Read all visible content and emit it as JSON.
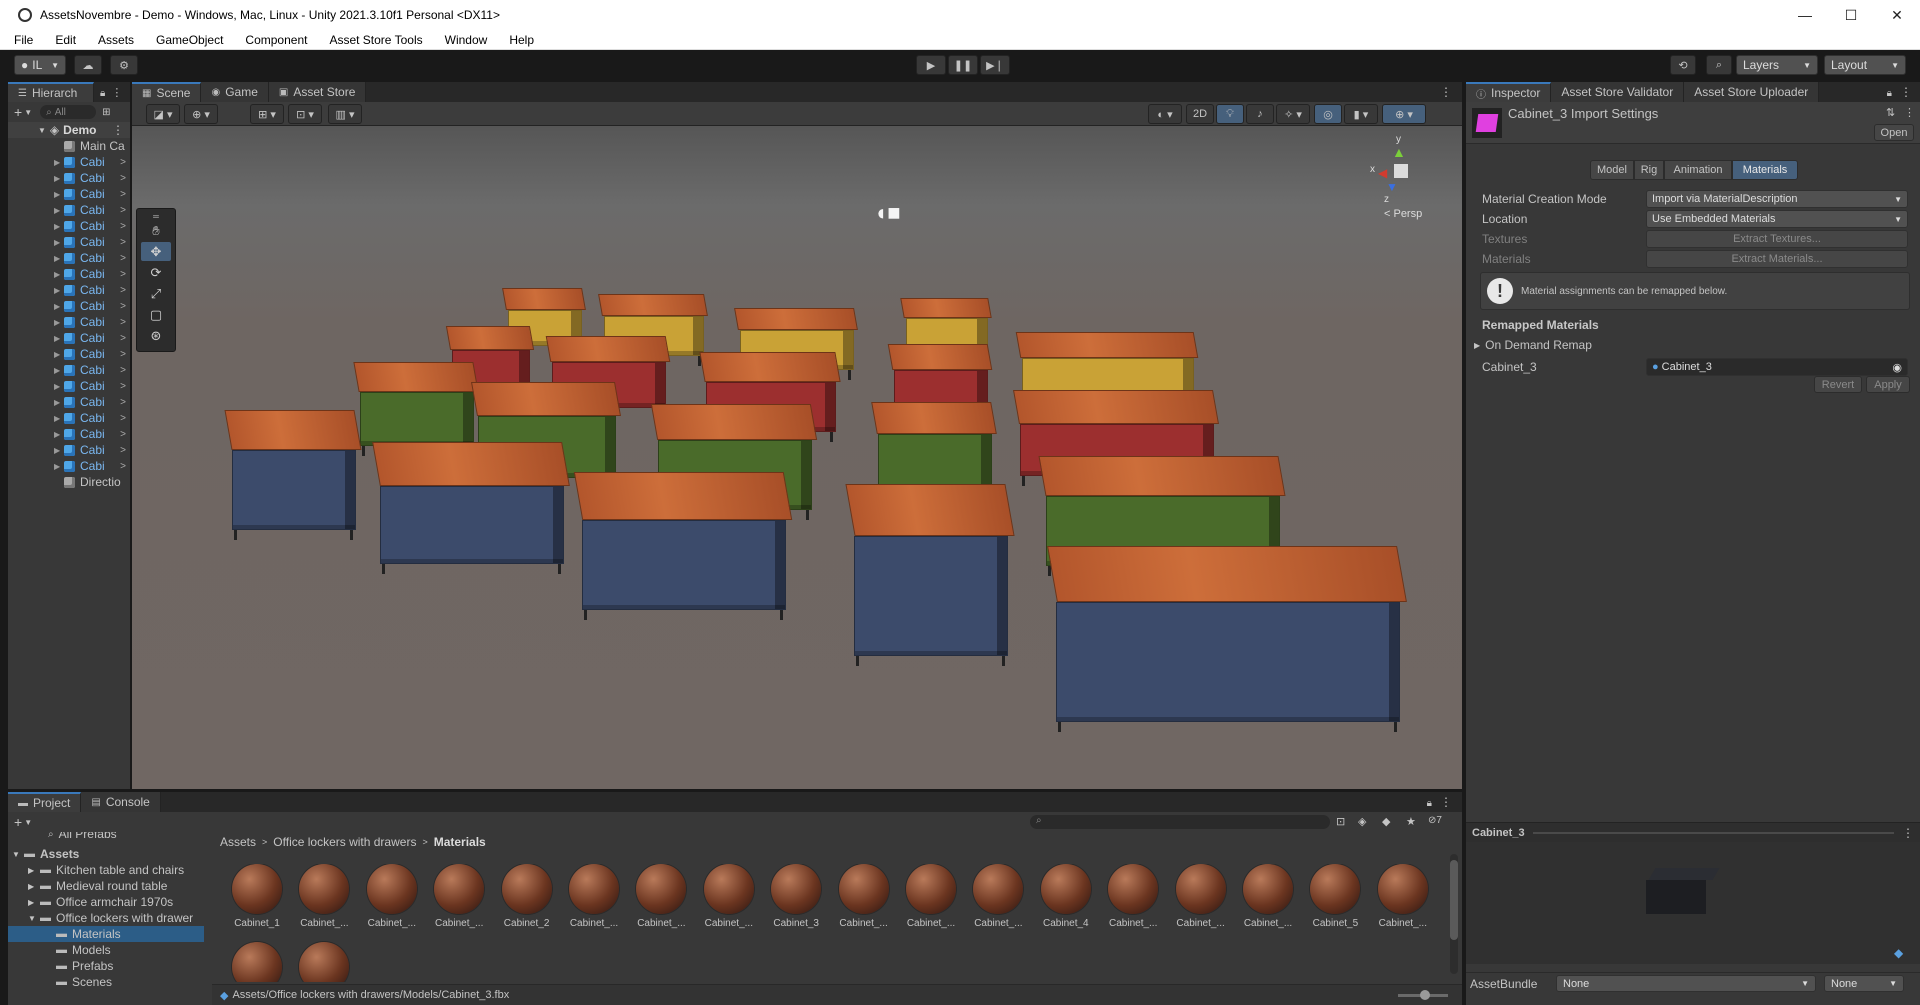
{
  "window": {
    "title": "AssetsNovembre - Demo - Windows, Mac, Linux - Unity 2021.3.10f1 Personal <DX11>",
    "minimize": "—",
    "maximize": "☐",
    "close": "✕"
  },
  "menu": [
    "File",
    "Edit",
    "Assets",
    "GameObject",
    "Component",
    "Asset Store Tools",
    "Window",
    "Help"
  ],
  "toolbar": {
    "account": "IL",
    "layers_label": "Layers",
    "layout_label": "Layout",
    "play": "▶",
    "pause": "❚❚",
    "step": "▶❘"
  },
  "hierarchy": {
    "tab_label": "Hierarch",
    "search_placeholder": "All",
    "scene_name": "Demo",
    "items": [
      "Main Ca",
      "Cabi",
      "Cabi",
      "Cabi",
      "Cabi",
      "Cabi",
      "Cabi",
      "Cabi",
      "Cabi",
      "Cabi",
      "Cabi",
      "Cabi",
      "Cabi",
      "Cabi",
      "Cabi",
      "Cabi",
      "Cabi",
      "Cabi",
      "Cabi",
      "Cabi",
      "Cabi",
      "Directio"
    ]
  },
  "scene": {
    "tabs": [
      "Scene",
      "Game",
      "Asset Store"
    ],
    "mode_2d": "2D",
    "persp_label": "< Persp",
    "gizmo_y": "y",
    "gizmo_x": "x",
    "gizmo_z": "z"
  },
  "inspector": {
    "tabs": [
      "Inspector",
      "Asset Store Validator",
      "Asset Store Uploader"
    ],
    "header_title": "Cabinet_3 Import Settings",
    "open_button": "Open",
    "subtabs": [
      "Model",
      "Rig",
      "Animation",
      "Materials"
    ],
    "active_subtab": "Materials",
    "fields": [
      {
        "label": "Material Creation Mode",
        "value": "Import via MaterialDescription"
      },
      {
        "label": "Location",
        "value": "Use Embedded Materials"
      },
      {
        "label": "Textures",
        "value": "Extract Textures..."
      },
      {
        "label": "Materials",
        "value": "Extract Materials..."
      }
    ],
    "info_message": "Material assignments can be remapped below.",
    "remapped_header": "Remapped Materials",
    "on_demand_remap": "On Demand Remap",
    "remap_label": "Cabinet_3",
    "remap_value": "Cabinet_3",
    "revert_button": "Revert",
    "apply_button": "Apply",
    "preview_title": "Cabinet_3",
    "assetbundle_label": "AssetBundle",
    "assetbundle_value": "None",
    "assetbundle_variant": "None"
  },
  "project": {
    "tabs": [
      "Project",
      "Console"
    ],
    "tree_top": "All Prefabs",
    "assets_root": "Assets",
    "folders": [
      "Kitchen table and chairs",
      "Medieval round table",
      "Office armchair 1970s",
      "Office lockers with drawer"
    ],
    "subfolders": [
      "Materials",
      "Models",
      "Prefabs",
      "Scenes"
    ],
    "breadcrumb": [
      "Assets",
      "Office lockers with drawers",
      "Materials"
    ],
    "hidden_count": "7",
    "materials": [
      "Cabinet_1",
      "Cabinet_...",
      "Cabinet_...",
      "Cabinet_...",
      "Cabinet_2",
      "Cabinet_...",
      "Cabinet_...",
      "Cabinet_...",
      "Cabinet_3",
      "Cabinet_...",
      "Cabinet_...",
      "Cabinet_...",
      "Cabinet_4",
      "Cabinet_...",
      "Cabinet_...",
      "Cabinet_...",
      "Cabinet_5",
      "Cabinet_..."
    ],
    "status_path": "Assets/Office lockers with drawers/Models/Cabinet_3.fbx"
  },
  "colors": {
    "accent_blue": "#3a79bb",
    "cabinet_wood": "#c4652f",
    "cabinet_yellow": "#c9a236",
    "cabinet_red": "#9c2f2f",
    "cabinet_green": "#4a6b2a",
    "cabinet_blue": "#3c4b6b"
  }
}
